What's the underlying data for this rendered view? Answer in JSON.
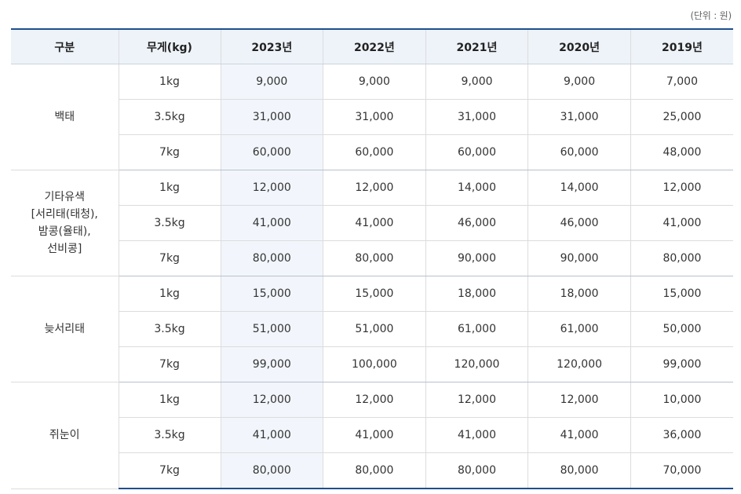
{
  "unit_note": "(단위 : 원)",
  "columns": [
    "구분",
    "무게(kg)",
    "2023년",
    "2022년",
    "2021년",
    "2020년",
    "2019년"
  ],
  "groups": [
    {
      "name_lines": [
        "백태"
      ],
      "rows": [
        {
          "weight": "1kg",
          "values": [
            "9,000",
            "9,000",
            "9,000",
            "9,000",
            "7,000"
          ]
        },
        {
          "weight": "3.5kg",
          "values": [
            "31,000",
            "31,000",
            "31,000",
            "31,000",
            "25,000"
          ]
        },
        {
          "weight": "7kg",
          "values": [
            "60,000",
            "60,000",
            "60,000",
            "60,000",
            "48,000"
          ]
        }
      ]
    },
    {
      "name_lines": [
        "기타유색",
        "[서리태(태청),",
        "밤콩(율태),",
        "선비콩]"
      ],
      "rows": [
        {
          "weight": "1kg",
          "values": [
            "12,000",
            "12,000",
            "14,000",
            "14,000",
            "12,000"
          ]
        },
        {
          "weight": "3.5kg",
          "values": [
            "41,000",
            "41,000",
            "46,000",
            "46,000",
            "41,000"
          ]
        },
        {
          "weight": "7kg",
          "values": [
            "80,000",
            "80,000",
            "90,000",
            "90,000",
            "80,000"
          ]
        }
      ]
    },
    {
      "name_lines": [
        "늦서리태"
      ],
      "rows": [
        {
          "weight": "1kg",
          "values": [
            "15,000",
            "15,000",
            "18,000",
            "18,000",
            "15,000"
          ]
        },
        {
          "weight": "3.5kg",
          "values": [
            "51,000",
            "51,000",
            "61,000",
            "61,000",
            "50,000"
          ]
        },
        {
          "weight": "7kg",
          "values": [
            "99,000",
            "100,000",
            "120,000",
            "120,000",
            "99,000"
          ]
        }
      ]
    },
    {
      "name_lines": [
        "쥐눈이"
      ],
      "rows": [
        {
          "weight": "1kg",
          "values": [
            "12,000",
            "12,000",
            "12,000",
            "12,000",
            "10,000"
          ]
        },
        {
          "weight": "3.5kg",
          "values": [
            "41,000",
            "41,000",
            "41,000",
            "41,000",
            "36,000"
          ]
        },
        {
          "weight": "7kg",
          "values": [
            "80,000",
            "80,000",
            "80,000",
            "80,000",
            "70,000"
          ]
        }
      ]
    }
  ],
  "colors": {
    "header_bg": "#eef3f9",
    "header_top_border": "#1f4e8c",
    "highlight_column_bg": "#f2f6fc",
    "grid_line": "#dcdcdc"
  }
}
